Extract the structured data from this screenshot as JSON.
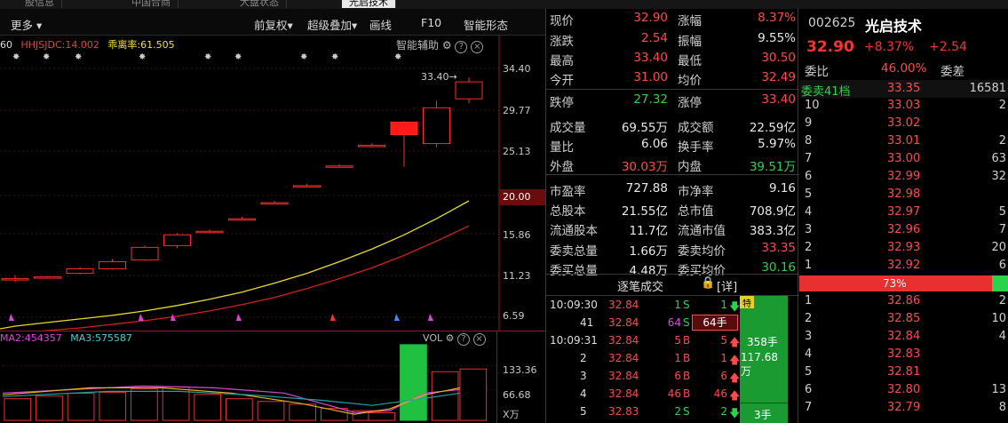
{
  "tabs": [
    "股信息",
    "中国合商",
    "大盘状态",
    "光启技术"
  ],
  "toolbar": {
    "more": "更多",
    "fuquan": "前复权",
    "overlay": "超级叠加",
    "draw": "画线",
    "f10": "F10",
    "smart": "智能形态"
  },
  "indicators": {
    "i1": "60",
    "i2": "HHJSJDC:14.002",
    "i3": "乖离率:61.505",
    "assist": "智能辅助",
    "tip": "33.40→"
  },
  "y_axis": [
    "34.40",
    "29.77",
    "25.13",
    "20.00",
    "15.86",
    "11.23",
    "6.59"
  ],
  "vol": {
    "ma2": "MA2:454357",
    "ma3": "MA3:575587",
    "label": "VOL",
    "ticks": [
      "133.36",
      "66.68",
      "X万"
    ]
  },
  "chart_data": {
    "type": "candlestick",
    "ylim": [
      6.59,
      34.4
    ],
    "candles": [
      {
        "o": 10.9,
        "c": 10.9,
        "h": 11.3,
        "l": 10.5
      },
      {
        "o": 11.0,
        "c": 11.1,
        "h": 11.2,
        "l": 10.9
      },
      {
        "o": 11.5,
        "c": 12.0,
        "h": 12.2,
        "l": 11.4
      },
      {
        "o": 12.0,
        "c": 12.8,
        "h": 13.1,
        "l": 11.9
      },
      {
        "o": 13.0,
        "c": 14.4,
        "h": 14.6,
        "l": 12.9
      },
      {
        "o": 14.6,
        "c": 15.8,
        "h": 16.0,
        "l": 14.3
      },
      {
        "o": 16.2,
        "c": 16.2,
        "h": 16.4,
        "l": 16.0
      },
      {
        "o": 17.6,
        "c": 17.6,
        "h": 17.8,
        "l": 17.4
      },
      {
        "o": 19.4,
        "c": 19.4,
        "h": 19.6,
        "l": 19.2
      },
      {
        "o": 21.3,
        "c": 21.3,
        "h": 21.5,
        "l": 21.1
      },
      {
        "o": 23.5,
        "c": 23.5,
        "h": 23.7,
        "l": 23.3
      },
      {
        "o": 25.8,
        "c": 25.8,
        "h": 26.0,
        "l": 25.6
      },
      {
        "o": 27.0,
        "c": 28.4,
        "h": 28.5,
        "l": 23.4
      },
      {
        "o": 26.0,
        "c": 30.0,
        "h": 30.8,
        "l": 25.6
      },
      {
        "o": 31.0,
        "c": 32.9,
        "h": 33.4,
        "l": 30.5
      }
    ],
    "ma_yellow": [
      5.6,
      6.0,
      6.4,
      6.8,
      7.3,
      7.9,
      8.6,
      9.4,
      10.4,
      11.5,
      12.8,
      14.2,
      15.8,
      17.6,
      19.6
    ],
    "ma_red": [
      4.8,
      5.1,
      5.4,
      5.8,
      6.2,
      6.7,
      7.3,
      8.0,
      8.8,
      9.8,
      10.9,
      12.1,
      13.5,
      15.1,
      16.8
    ],
    "volumes": [
      40,
      45,
      50,
      52,
      58,
      62,
      48,
      40,
      35,
      30,
      22,
      18,
      14,
      140,
      90,
      95
    ],
    "volume_colors": [
      "red",
      "red",
      "red",
      "red",
      "red",
      "red",
      "red",
      "red",
      "red",
      "red",
      "red",
      "red",
      "red",
      "green",
      "red",
      "red"
    ]
  },
  "quote": {
    "rows": [
      {
        "l1": "现价",
        "v1": "32.90",
        "c1": "red",
        "l2": "涨幅",
        "v2": "8.37%",
        "c2": "red"
      },
      {
        "l1": "涨跌",
        "v1": "2.54",
        "c1": "red",
        "l2": "振幅",
        "v2": "9.55%",
        "c2": "white"
      },
      {
        "l1": "最高",
        "v1": "33.40",
        "c1": "red",
        "l2": "最低",
        "v2": "30.50",
        "c2": "red"
      },
      {
        "l1": "今开",
        "v1": "31.00",
        "c1": "red",
        "l2": "均价",
        "v2": "32.49",
        "c2": "red"
      },
      {
        "l1": "跌停",
        "v1": "27.32",
        "c1": "green",
        "l2": "涨停",
        "v2": "33.40",
        "c2": "red"
      },
      {
        "l1": "成交量",
        "v1": "69.55万",
        "c1": "white",
        "l2": "成交额",
        "v2": "22.59亿",
        "c2": "white"
      },
      {
        "l1": "量比",
        "v1": "6.06",
        "c1": "white",
        "l2": "换手率",
        "v2": "5.97%",
        "c2": "white"
      },
      {
        "l1": "外盘",
        "v1": "30.03万",
        "c1": "red",
        "l2": "内盘",
        "v2": "39.51万",
        "c2": "green"
      },
      {
        "l1": "市盈率",
        "v1": "727.88",
        "c1": "white",
        "l2": "市净率",
        "v2": "9.16",
        "c2": "white"
      },
      {
        "l1": "总股本",
        "v1": "21.55亿",
        "c1": "white",
        "l2": "总市值",
        "v2": "708.9亿",
        "c2": "white"
      },
      {
        "l1": "流通股本",
        "v1": "11.7亿",
        "c1": "white",
        "l2": "流通市值",
        "v2": "383.3亿",
        "c2": "white"
      },
      {
        "l1": "委卖总量",
        "v1": "1.66万",
        "c1": "white",
        "l2": "委卖均价",
        "v2": "33.35",
        "c2": "red"
      },
      {
        "l1": "委买总量",
        "v1": "4.48万",
        "c1": "white",
        "l2": "委买均价",
        "v2": "30.16",
        "c2": "green"
      }
    ],
    "ticks_header": "逐笔成交",
    "detail": "[详]",
    "ticks": [
      {
        "t": "10:09:30",
        "p": "32.84",
        "a": "1",
        "s": "S",
        "b": "1",
        "dir": "down"
      },
      {
        "t": "41",
        "p": "32.84",
        "a": "64",
        "s": "S",
        "b": "64手",
        "dir": "box"
      },
      {
        "t": "10:09:31",
        "p": "32.84",
        "a": "5",
        "s": "B",
        "b": "5",
        "dir": "up"
      },
      {
        "t": "2",
        "p": "32.84",
        "a": "1",
        "s": "B",
        "b": "1",
        "dir": "up"
      },
      {
        "t": "3",
        "p": "32.84",
        "a": "6",
        "s": "B",
        "b": "6",
        "dir": "up"
      },
      {
        "t": "4",
        "p": "32.84",
        "a": "46",
        "s": "B",
        "b": "46",
        "dir": "up"
      },
      {
        "t": "5",
        "p": "32.83",
        "a": "2",
        "s": "S",
        "b": "2",
        "dir": "down"
      }
    ],
    "big": {
      "tag": "特",
      "vol": "358手",
      "amt": "117.68万",
      "small": "3手"
    }
  },
  "book": {
    "code": "002625",
    "name": "光启技术",
    "price": "32.90",
    "pct": "+8.37%",
    "chg": "+2.54",
    "webi_label": "委比",
    "webi": "46.00%",
    "weicha_label": "委差",
    "sell_header": "委卖41档",
    "sell_header_price": "33.35",
    "sell_header_qty": "16581",
    "sells": [
      {
        "n": "10",
        "p": "33.03",
        "q": "2"
      },
      {
        "n": "9",
        "p": "33.02",
        "q": ""
      },
      {
        "n": "8",
        "p": "33.01",
        "q": "2"
      },
      {
        "n": "7",
        "p": "33.00",
        "q": "63"
      },
      {
        "n": "6",
        "p": "32.99",
        "q": "32"
      },
      {
        "n": "5",
        "p": "32.98",
        "q": ""
      },
      {
        "n": "4",
        "p": "32.97",
        "q": "5"
      },
      {
        "n": "3",
        "p": "32.96",
        "q": "7"
      },
      {
        "n": "2",
        "p": "32.93",
        "q": "20"
      },
      {
        "n": "1",
        "p": "32.92",
        "q": "6"
      }
    ],
    "ratio": "73%",
    "buys": [
      {
        "n": "1",
        "p": "32.86",
        "q": "2"
      },
      {
        "n": "2",
        "p": "32.85",
        "q": "10"
      },
      {
        "n": "3",
        "p": "32.84",
        "q": "4"
      },
      {
        "n": "4",
        "p": "32.83",
        "q": ""
      },
      {
        "n": "5",
        "p": "32.81",
        "q": ""
      },
      {
        "n": "6",
        "p": "32.80",
        "q": "13"
      },
      {
        "n": "7",
        "p": "32.79",
        "q": "8"
      }
    ]
  }
}
